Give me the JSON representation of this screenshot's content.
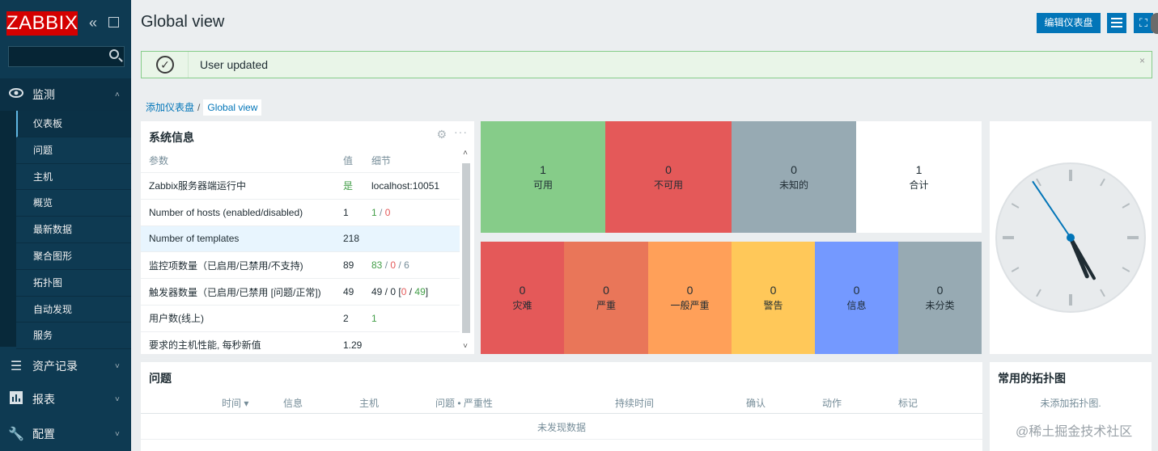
{
  "sidebar": {
    "logo": "ZABBIX",
    "search_placeholder": "",
    "sections": {
      "monitoring": "监测",
      "assets": "资产记录",
      "reports": "报表",
      "config": "配置"
    },
    "monitoring_items": [
      "仪表板",
      "问题",
      "主机",
      "概览",
      "最新数据",
      "聚合图形",
      "拓扑图",
      "自动发现",
      "服务"
    ],
    "active_item": "仪表板"
  },
  "header": {
    "title": "Global view",
    "edit_button": "编辑仪表盘"
  },
  "message": {
    "text": "User updated",
    "close": "×"
  },
  "breadcrumb": {
    "parent": "添加仪表盘",
    "separator": "/",
    "current": "Global view"
  },
  "system_info": {
    "title": "系统信息",
    "columns": [
      "参数",
      "值",
      "细节"
    ],
    "rows": [
      {
        "param": "Zabbix服务器端运行中",
        "value": "是",
        "detail": "localhost:10051"
      },
      {
        "param": "Number of hosts (enabled/disabled)",
        "value": "1",
        "d1": "1",
        "s1": " / ",
        "d2": "0"
      },
      {
        "param": "Number of templates",
        "value": "218",
        "detail": ""
      },
      {
        "param": "监控项数量（已启用/已禁用/不支持)",
        "value": "89",
        "d1": "83",
        "s1": " / ",
        "d2": "0",
        "s2": " / ",
        "d3": "6"
      },
      {
        "param": "触发器数量（已启用/已禁用 [问题/正常])",
        "value": "49",
        "d1": "49 / 0 [",
        "d2": "0",
        "s2": " / ",
        "d3": "49",
        "s3": "]"
      },
      {
        "param": "用户数(线上)",
        "value": "2",
        "detail": "1"
      },
      {
        "param": "要求的主机性能, 每秒新值",
        "value": "1.29",
        "detail": ""
      }
    ]
  },
  "host_availability": {
    "tiles": [
      {
        "num": "1",
        "label": "可用",
        "color": "#86cc89"
      },
      {
        "num": "0",
        "label": "不可用",
        "color": "#e45959"
      },
      {
        "num": "0",
        "label": "未知的",
        "color": "#97aab3"
      },
      {
        "num": "1",
        "label": "合计",
        "color": "#ffffff"
      }
    ]
  },
  "problems_by_severity": {
    "tiles": [
      {
        "num": "0",
        "label": "灾难",
        "color": "#e45959"
      },
      {
        "num": "0",
        "label": "严重",
        "color": "#e97659"
      },
      {
        "num": "0",
        "label": "一般严重",
        "color": "#ffa059"
      },
      {
        "num": "0",
        "label": "警告",
        "color": "#ffc859"
      },
      {
        "num": "0",
        "label": "信息",
        "color": "#7499ff"
      },
      {
        "num": "0",
        "label": "未分类",
        "color": "#97aab3"
      }
    ]
  },
  "clock": {
    "hour_angle": 157,
    "minute_angle": 150,
    "second_angle": 326
  },
  "problems": {
    "title": "问题",
    "columns": [
      "时间 ▾",
      "信息",
      "主机",
      "问题 • 严重性",
      "持续时间",
      "确认",
      "动作",
      "标记"
    ],
    "empty": "未发现数据"
  },
  "maps": {
    "title": "常用的拓扑图",
    "empty": "未添加拓扑图."
  },
  "watermark": "@稀土掘金技术社区"
}
